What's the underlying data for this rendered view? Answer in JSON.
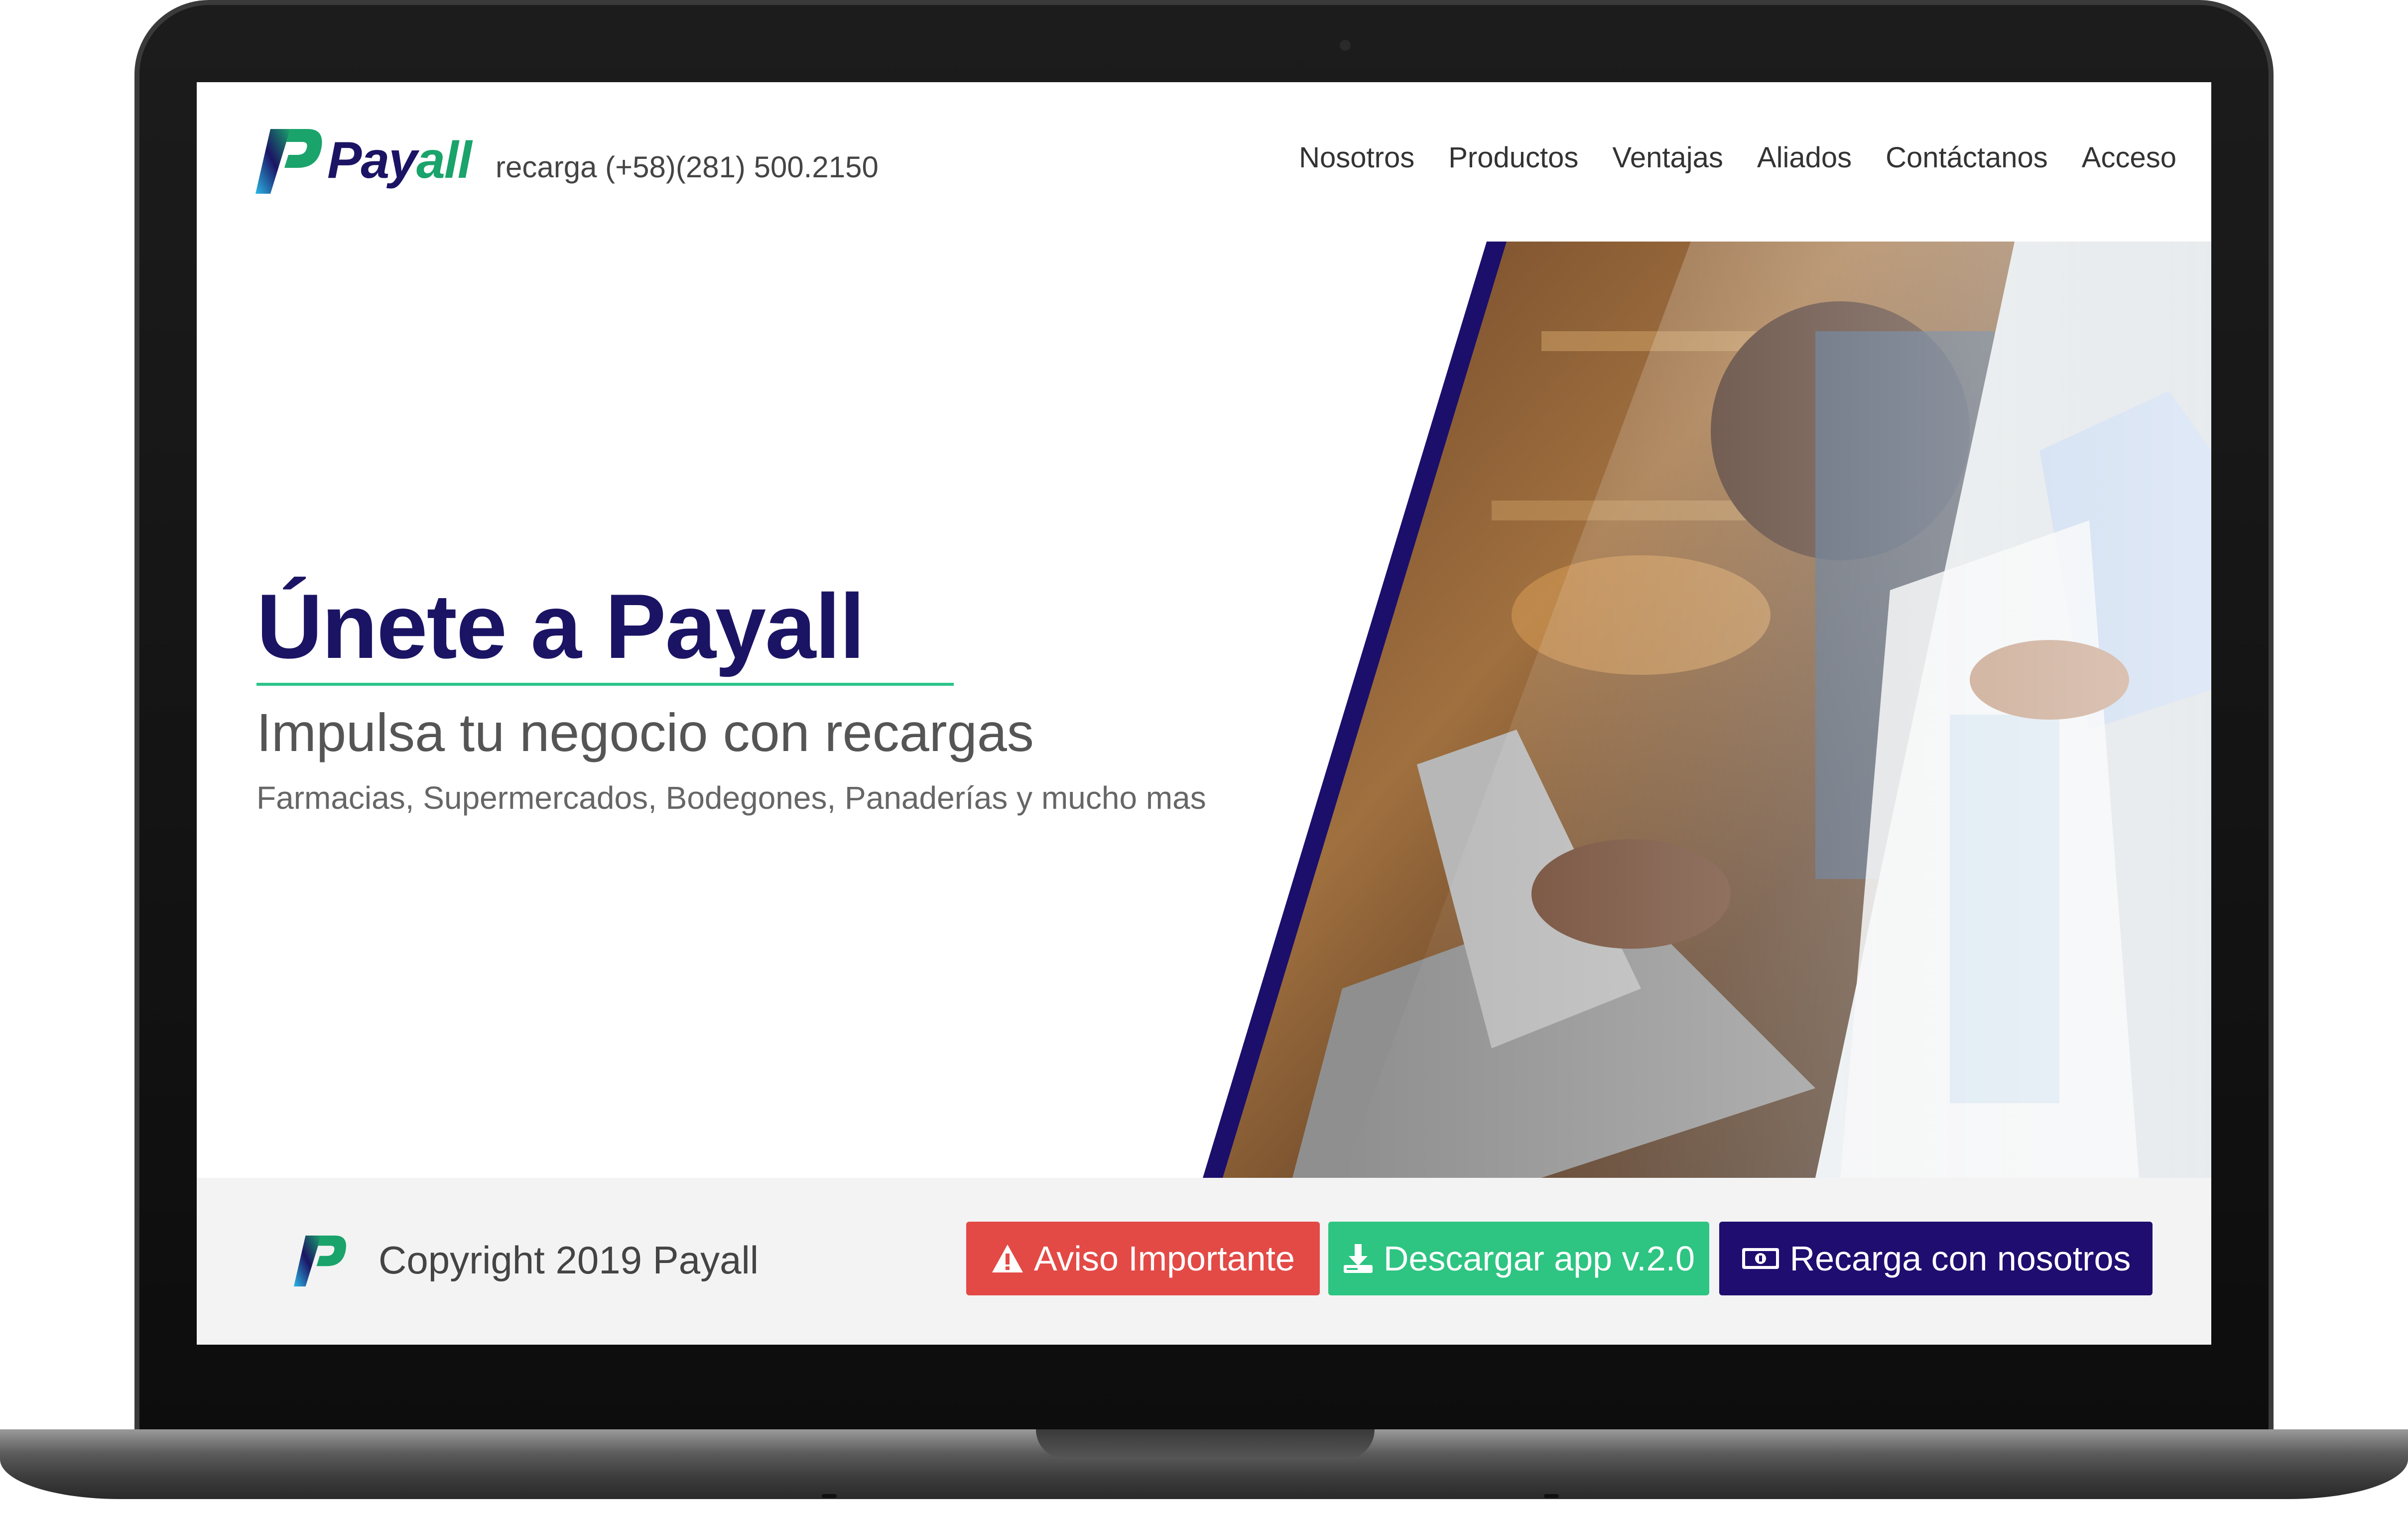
{
  "header": {
    "brand_pay": "Pay",
    "brand_all": "all",
    "phone": "recarga (+58)(281) 500.2150",
    "nav": [
      "Nosotros",
      "Productos",
      "Ventajas",
      "Aliados",
      "Contáctanos",
      "Acceso"
    ]
  },
  "hero": {
    "title": "Únete a Payall",
    "subtitle": "Impulsa tu negocio con recargas",
    "tagline": "Farmacias, Supermercados, Bodegones, Panaderías y mucho mas"
  },
  "footer": {
    "copyright": "Copyright 2019 Payall",
    "buttons": {
      "aviso": "Aviso Importante",
      "app": "Descargar app v.2.0",
      "recarga": "Recarga con nosotros"
    }
  },
  "icons": {
    "aviso": "warning-icon",
    "app": "download-icon",
    "recarga": "money-icon"
  },
  "colors": {
    "brand_navy": "#1b1464",
    "brand_green": "#1aa36b",
    "accent_line": "#2bc48a",
    "btn_red": "#e34a46",
    "btn_green": "#2ec482",
    "btn_navy": "#1f0d70"
  }
}
